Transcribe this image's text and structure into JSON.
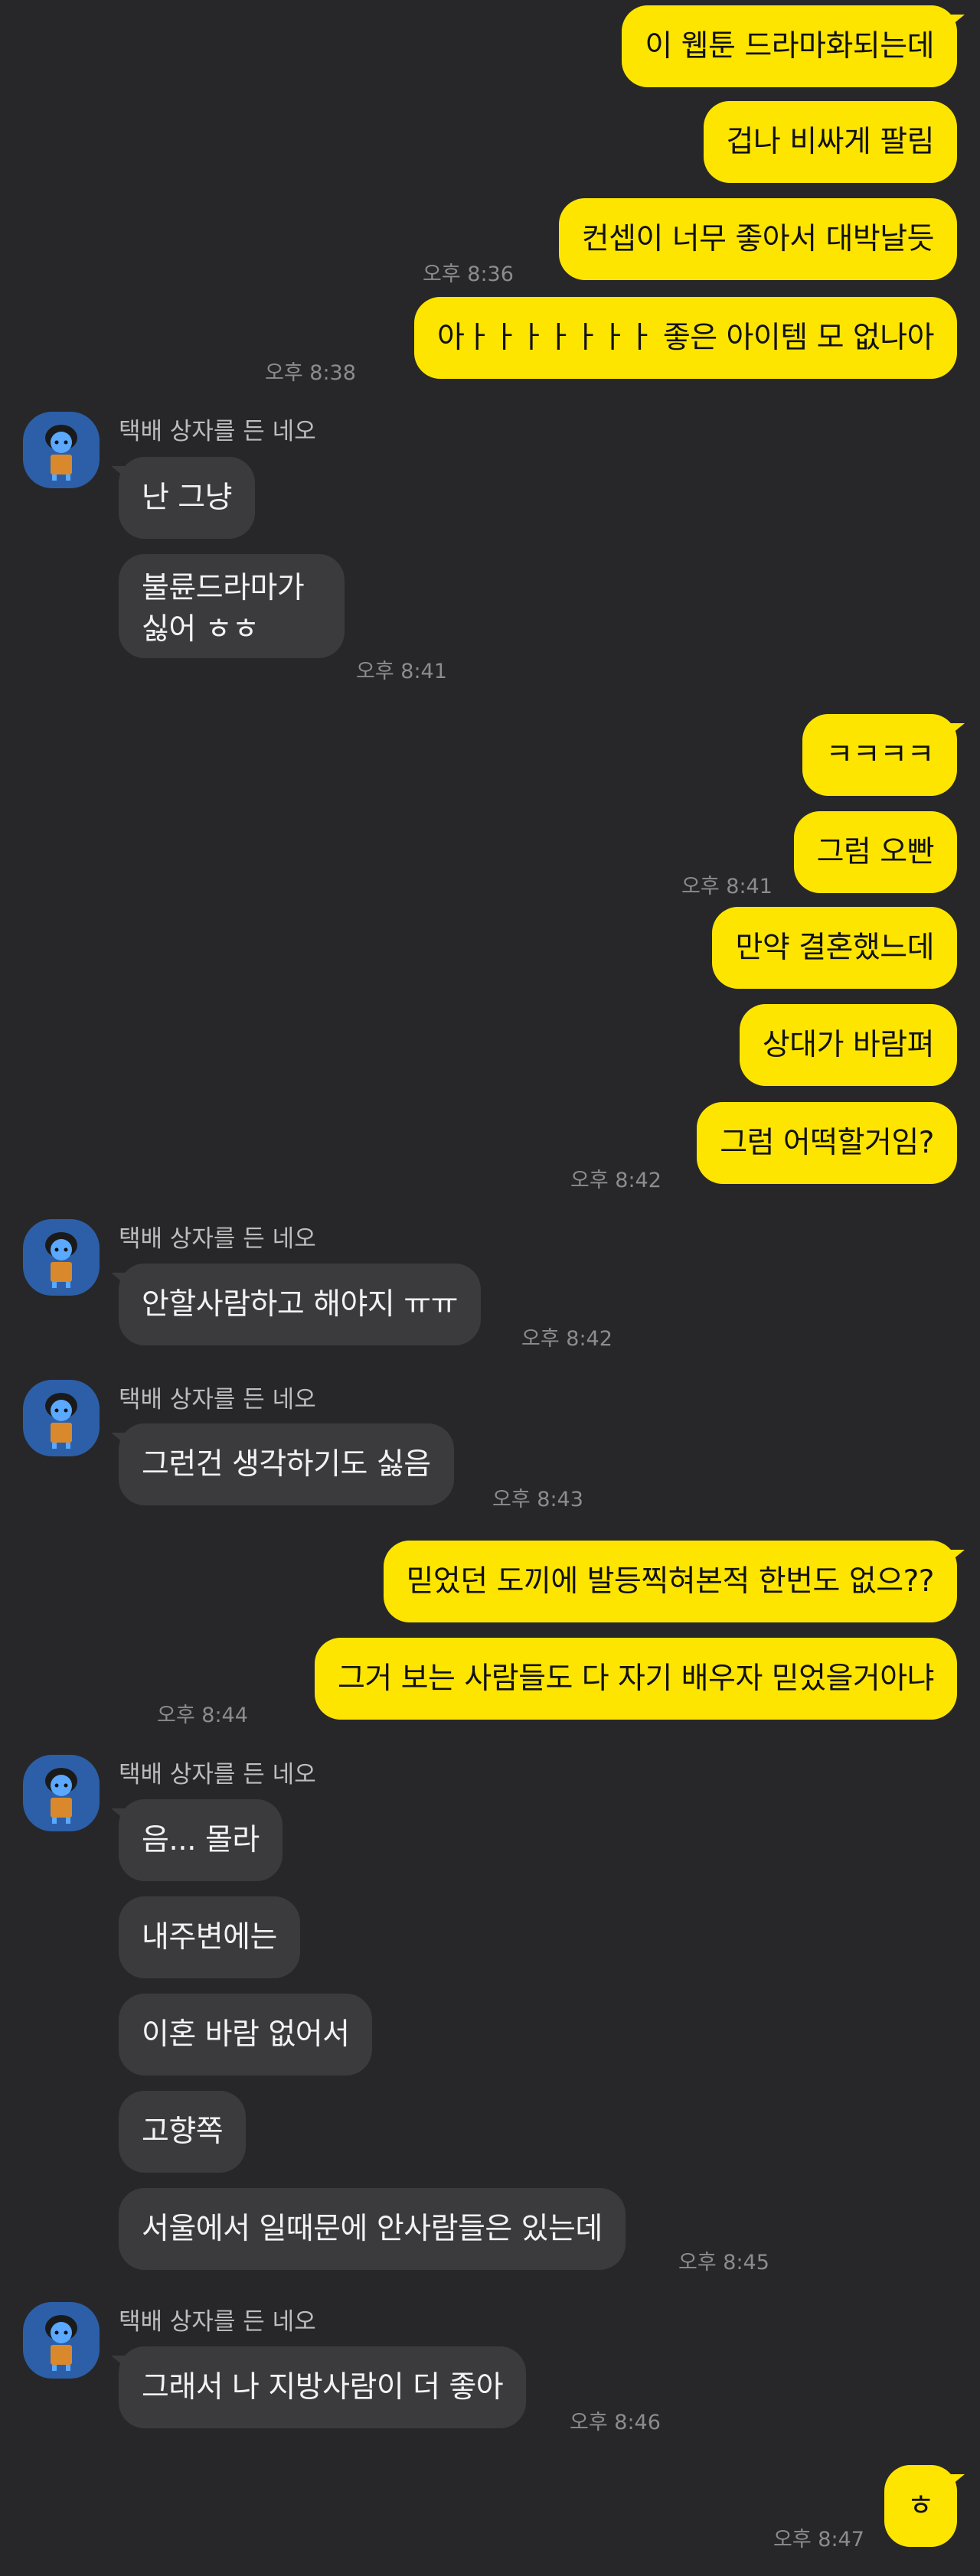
{
  "sender_name": "택배 상자를 든 네오",
  "messages": [
    {
      "text": "이 웹툰 드라마화되는데"
    },
    {
      "text": "겁나 비싸게 팔림"
    },
    {
      "text": "컨셉이 너무 좋아서 대박날듯"
    },
    {
      "text": "아ㅏㅏㅏㅏㅏㅏㅏ 좋은 아이템 모 없나아"
    },
    {
      "text": "난 그냥"
    },
    {
      "text": "불륜드라마가 싫어 ㅎㅎ"
    },
    {
      "text": "ㅋㅋㅋㅋ"
    },
    {
      "text": "그럼 오빤"
    },
    {
      "text": "만약 결혼했느데"
    },
    {
      "text": "상대가 바람펴"
    },
    {
      "text": "그럼 어떡할거임?"
    },
    {
      "text": "안할사람하고 해야지 ㅠㅠ"
    },
    {
      "text": "그런건 생각하기도 싫음"
    },
    {
      "text": "믿었던 도끼에 발등찍혀본적 한번도 없으??"
    },
    {
      "text": "그거 보는 사람들도 다 자기 배우자 믿었을거아냐"
    },
    {
      "text": "음... 몰라"
    },
    {
      "text": "내주변에는"
    },
    {
      "text": "이혼 바람 없어서"
    },
    {
      "text": "고향쪽"
    },
    {
      "text": "서울에서 일때문에 안사람들은 있는데"
    },
    {
      "text": "그래서 나 지방사람이 더 좋아"
    },
    {
      "text": "ㅎ"
    }
  ],
  "times": [
    "오후 8:36",
    "오후 8:38",
    "오후 8:41",
    "오후 8:41",
    "오후 8:42",
    "오후 8:42",
    "오후 8:43",
    "오후 8:44",
    "오후 8:45",
    "오후 8:46",
    "오후 8:47"
  ],
  "colors": {
    "background": "#272729",
    "outgoing": "#FEE500",
    "incoming": "#3B3B3E",
    "avatar": "#2D5FA8"
  }
}
